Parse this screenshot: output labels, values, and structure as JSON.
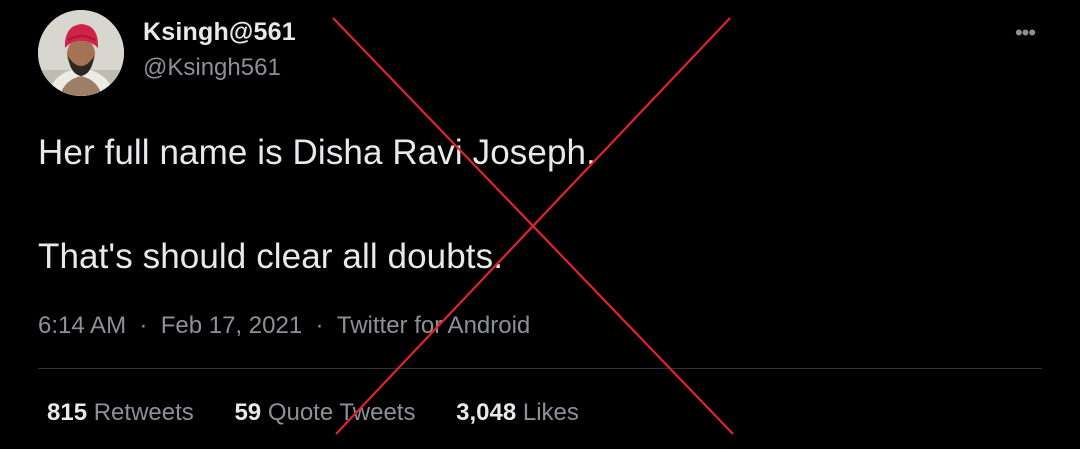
{
  "user": {
    "display_name": "Ksingh@561",
    "handle": "@Ksingh561"
  },
  "more_icon": "more-horizontal-icon",
  "tweet": {
    "line1": "Her full name is Disha Ravi Joseph.",
    "line2": "That's should clear all doubts.",
    "time": "6:14 AM",
    "date": "Feb 17, 2021",
    "source": "Twitter for Android"
  },
  "stats": {
    "retweets": "815",
    "retweets_label": "Retweets",
    "quote_tweets": "59",
    "quote_tweets_label": "Quote Tweets",
    "likes": "3,048",
    "likes_label": "Likes"
  },
  "colors": {
    "background": "#000000",
    "text_primary": "#e7e9ea",
    "text_secondary": "#8b9197",
    "divider": "#2f3336",
    "cross_mark": "#e0242a"
  }
}
